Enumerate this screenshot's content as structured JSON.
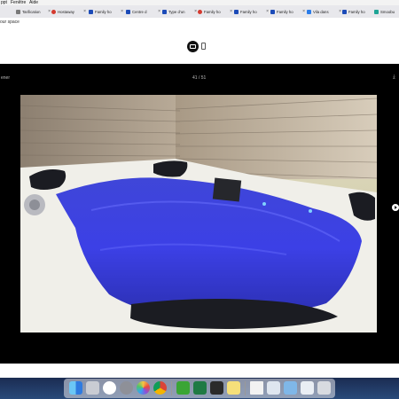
{
  "menubar": {
    "items": [
      "ppt",
      "Fenêtre",
      "Aide"
    ]
  },
  "tabs": [
    {
      "label": "Tarification",
      "icon": "page-icon"
    },
    {
      "label": "Hostaway",
      "icon": "hostaway-icon"
    },
    {
      "label": "Family ho",
      "icon": "booking-icon"
    },
    {
      "label": "Centre d",
      "icon": "booking-icon"
    },
    {
      "label": "Type d'un",
      "icon": "booking-icon"
    },
    {
      "label": "Family ho",
      "icon": "airbnb-icon"
    },
    {
      "label": "Family ho",
      "icon": "booking-icon"
    },
    {
      "label": "Family ho",
      "icon": "booking-icon"
    },
    {
      "label": "Vila dans",
      "icon": "vrbo-icon"
    },
    {
      "label": "Family ho",
      "icon": "booking-icon"
    },
    {
      "label": "Smoobu",
      "icon": "smoobu-icon"
    }
  ],
  "navbar": {
    "breadcrumb": "our space"
  },
  "viewer": {
    "left_label": "ener",
    "counter": "41 / 51",
    "download_icon": "download-icon",
    "next_icon": "chevron-right-icon"
  },
  "photo": {
    "subject": "hot-tub-image"
  },
  "dock": {
    "apps": [
      "finder-icon",
      "launchpad-icon",
      "music-icon",
      "system-preferences-icon",
      "photos-icon",
      "chrome-icon",
      "utorrent-icon",
      "excel-icon",
      "terminal-icon",
      "notes-icon",
      "document-icon",
      "preview-icon",
      "folder-icon",
      "image-icon",
      "trash-icon"
    ]
  }
}
